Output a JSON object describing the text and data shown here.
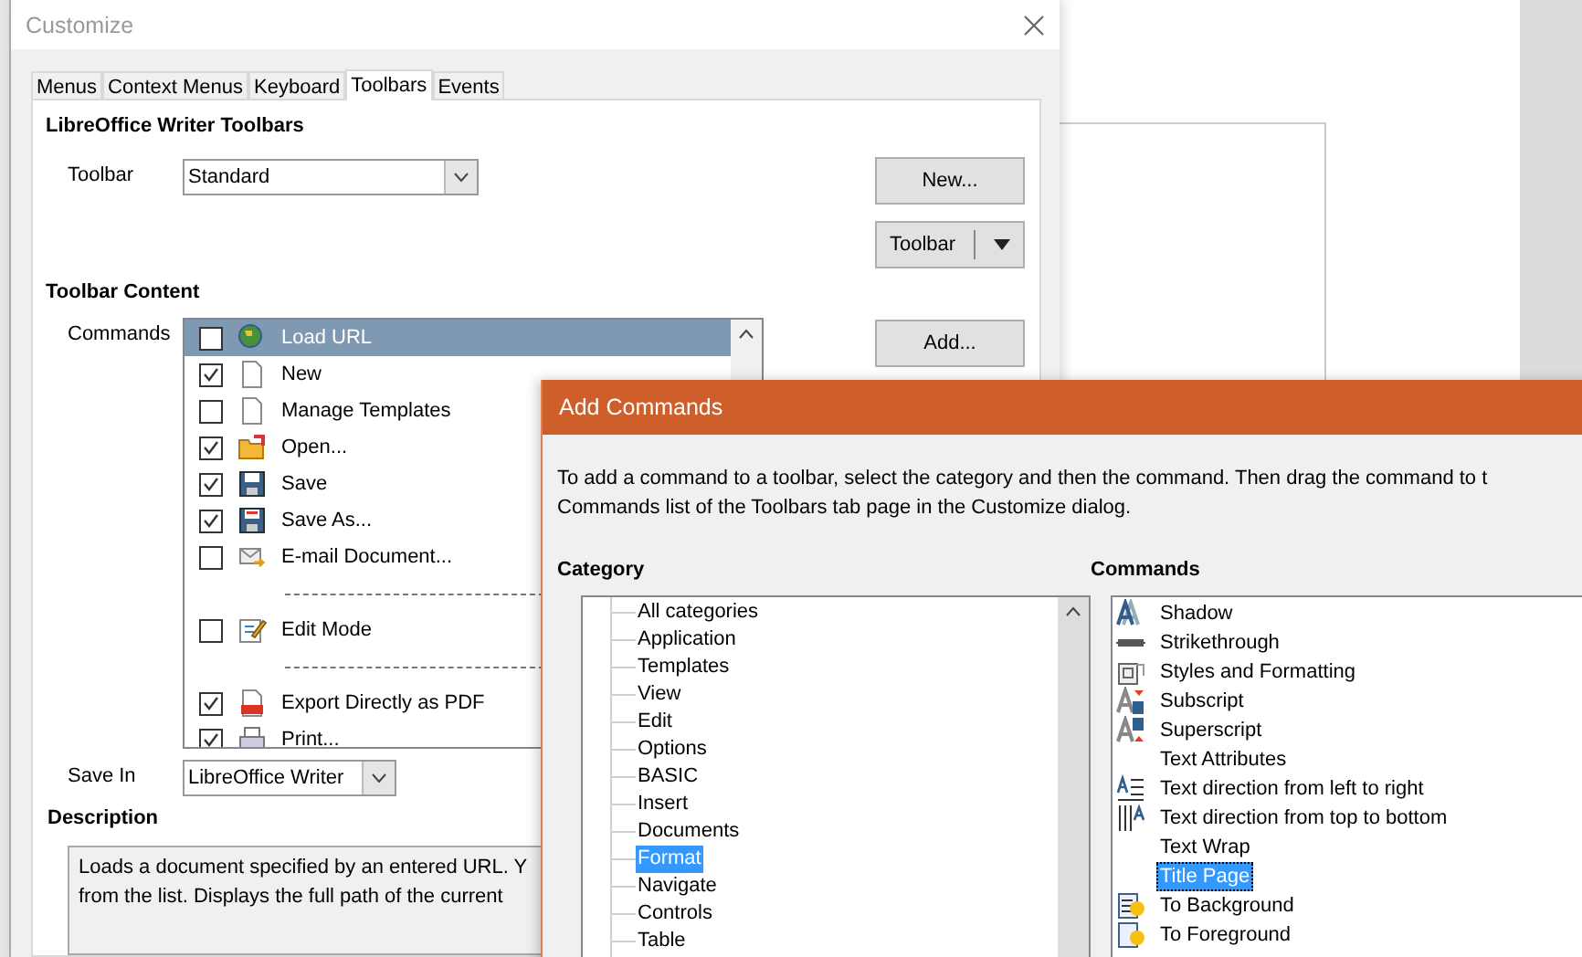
{
  "customize": {
    "title": "Customize",
    "tabs": [
      {
        "label": "Menus",
        "selected": false
      },
      {
        "label": "Context Menus",
        "selected": false
      },
      {
        "label": "Keyboard",
        "selected": false
      },
      {
        "label": "Toolbars",
        "selected": true
      },
      {
        "label": "Events",
        "selected": false
      }
    ],
    "toolbars_heading": "LibreOffice Writer Toolbars",
    "toolbar_label": "Toolbar",
    "toolbar_value": "Standard",
    "new_button": "New...",
    "toolbar_button": "Toolbar",
    "content_heading": "Toolbar Content",
    "commands_label": "Commands",
    "commands": [
      {
        "kind": "command",
        "label": "Load URL",
        "checked": false,
        "selected": true
      },
      {
        "kind": "command",
        "label": "New",
        "checked": true,
        "selected": false
      },
      {
        "kind": "command",
        "label": "Manage Templates",
        "checked": false,
        "selected": false
      },
      {
        "kind": "command",
        "label": "Open...",
        "checked": true,
        "selected": false
      },
      {
        "kind": "command",
        "label": "Save",
        "checked": true,
        "selected": false
      },
      {
        "kind": "command",
        "label": "Save As...",
        "checked": true,
        "selected": false
      },
      {
        "kind": "command",
        "label": "E-mail Document...",
        "checked": false,
        "selected": false
      },
      {
        "kind": "separator"
      },
      {
        "kind": "command",
        "label": "Edit Mode",
        "checked": false,
        "selected": false
      },
      {
        "kind": "separator"
      },
      {
        "kind": "command",
        "label": "Export Directly as PDF",
        "checked": true,
        "selected": false
      },
      {
        "kind": "command",
        "label": "Print...",
        "checked": true,
        "selected": false
      }
    ],
    "add_button": "Add...",
    "save_in_label": "Save In",
    "save_in_value": "LibreOffice Writer",
    "description_heading": "Description",
    "description": "Loads a document specified by an entered URL. Y\nfrom the list. Displays the full path of the current"
  },
  "add_commands": {
    "title": "Add Commands",
    "intro": "To add a command to a toolbar, select the category and then the command. Then drag the command to t\nCommands list of the Toolbars tab page in the Customize dialog.",
    "category_heading": "Category",
    "categories": [
      {
        "label": "All categories",
        "selected": false
      },
      {
        "label": "Application",
        "selected": false
      },
      {
        "label": "Templates",
        "selected": false
      },
      {
        "label": "View",
        "selected": false
      },
      {
        "label": "Edit",
        "selected": false
      },
      {
        "label": "Options",
        "selected": false
      },
      {
        "label": "BASIC",
        "selected": false
      },
      {
        "label": "Insert",
        "selected": false
      },
      {
        "label": "Documents",
        "selected": false
      },
      {
        "label": "Format",
        "selected": true
      },
      {
        "label": "Navigate",
        "selected": false
      },
      {
        "label": "Controls",
        "selected": false
      },
      {
        "label": "Table",
        "selected": false
      }
    ],
    "commands_heading": "Commands",
    "commands": [
      {
        "label": "Shadow",
        "selected": false
      },
      {
        "label": "Strikethrough",
        "selected": false
      },
      {
        "label": "Styles and Formatting",
        "selected": false
      },
      {
        "label": "Subscript",
        "selected": false
      },
      {
        "label": "Superscript",
        "selected": false
      },
      {
        "label": "Text Attributes",
        "selected": false
      },
      {
        "label": "Text direction from left to right",
        "selected": false
      },
      {
        "label": "Text direction from top to bottom",
        "selected": false
      },
      {
        "label": "Text Wrap",
        "selected": false
      },
      {
        "label": "Title Page",
        "selected": true
      },
      {
        "label": "To Background",
        "selected": false
      },
      {
        "label": "To Foreground",
        "selected": false
      }
    ]
  }
}
